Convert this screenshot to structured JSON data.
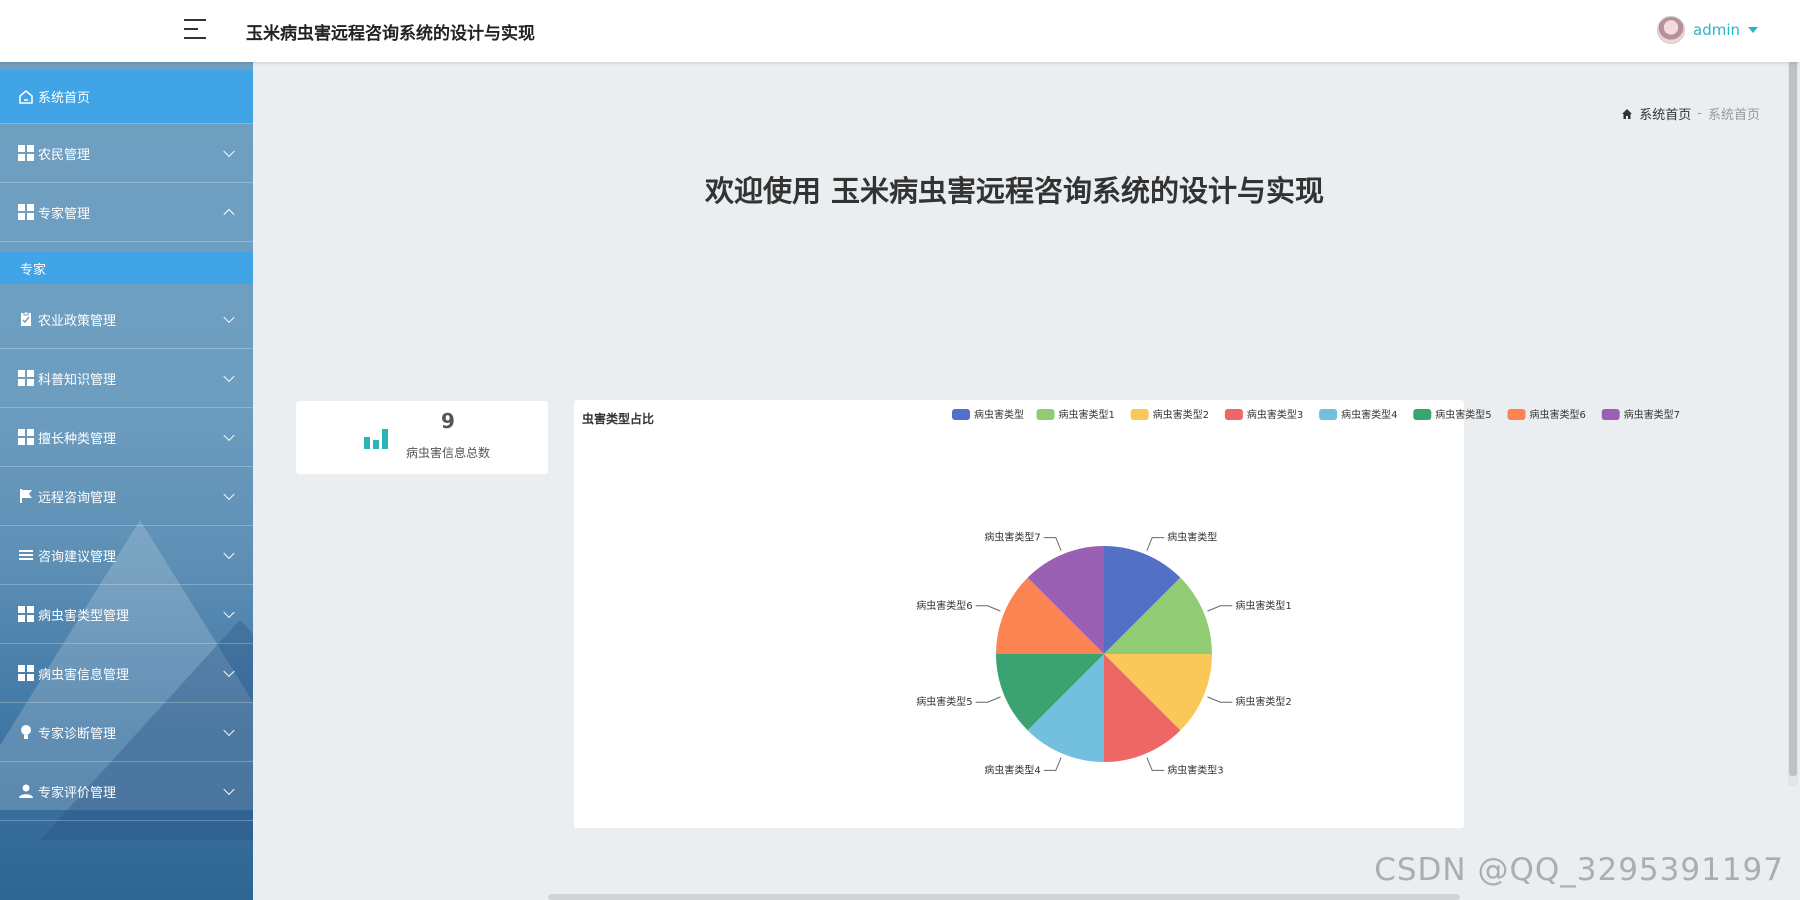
{
  "header": {
    "app_title": "玉米病虫害远程咨询系统的设计与实现",
    "username": "admin"
  },
  "sidebar": {
    "items": [
      {
        "label": "系统首页",
        "icon": "home-icon"
      },
      {
        "label": "农民管理",
        "icon": "grid-icon"
      },
      {
        "label": "专家管理",
        "icon": "grid-icon",
        "expanded": true
      },
      {
        "label": "专家",
        "sub": true
      },
      {
        "label": "农业政策管理",
        "icon": "clipboard-icon"
      },
      {
        "label": "科普知识管理",
        "icon": "grid-icon"
      },
      {
        "label": "擅长种类管理",
        "icon": "grid-icon"
      },
      {
        "label": "远程咨询管理",
        "icon": "flag-icon"
      },
      {
        "label": "咨询建议管理",
        "icon": "list-icon"
      },
      {
        "label": "病虫害类型管理",
        "icon": "grid-icon"
      },
      {
        "label": "病虫害信息管理",
        "icon": "grid-icon"
      },
      {
        "label": "专家诊断管理",
        "icon": "bulb-icon"
      },
      {
        "label": "专家评价管理",
        "icon": "user-icon"
      }
    ]
  },
  "breadcrumb": {
    "home": "系统首页",
    "separator": "-",
    "current": "系统首页"
  },
  "welcome": "欢迎使用 玉米病虫害远程咨询系统的设计与实现",
  "stat": {
    "value": "9",
    "label": "病虫害信息总数"
  },
  "chart_data": {
    "type": "pie",
    "title": "虫害类型占比",
    "categories": [
      "病虫害类型",
      "病虫害类型1",
      "病虫害类型2",
      "病虫害类型3",
      "病虫害类型4",
      "病虫害类型5",
      "病虫害类型6",
      "病虫害类型7"
    ],
    "values": [
      1,
      1,
      1,
      1,
      1,
      1,
      1,
      1
    ],
    "colors": [
      "#5470c6",
      "#91cc75",
      "#fac858",
      "#ee6666",
      "#73c0de",
      "#3ba272",
      "#fc8452",
      "#9a60b4"
    ],
    "legend_position": "top-right"
  },
  "watermark": "CSDN @QQ_3295391197"
}
